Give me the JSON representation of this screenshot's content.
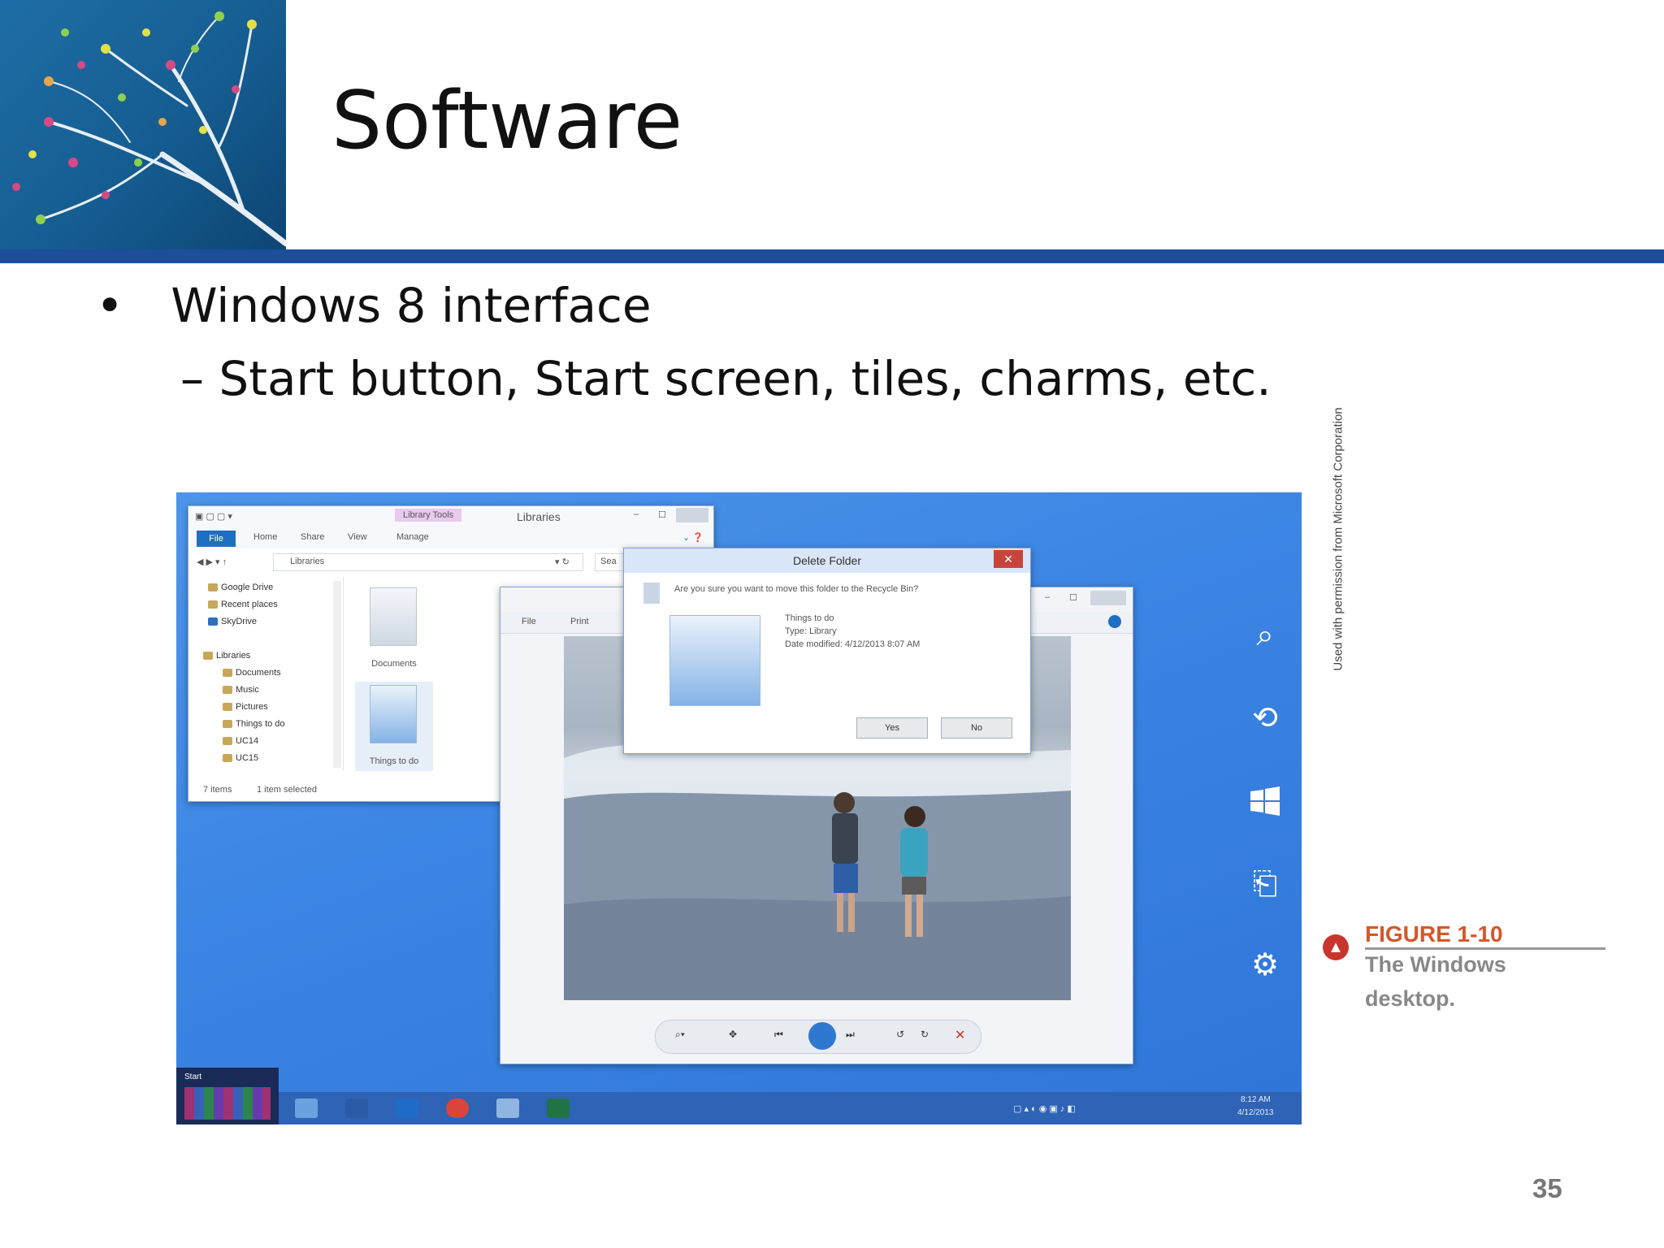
{
  "slide": {
    "title": "Software",
    "bullets": [
      {
        "text": "Windows 8 interface",
        "sub": "– Start button, Start screen, tiles, charms, etc."
      }
    ],
    "figure": {
      "label": "FIGURE 1-10",
      "caption_line1": "The Windows",
      "caption_line2": "desktop.",
      "credit": "Used with permission from Microsoft Corporation"
    },
    "page_number": "35"
  },
  "screenshot": {
    "explorer": {
      "title": "Libraries",
      "contextual_tab": "Library Tools",
      "tabs": [
        "File",
        "Home",
        "Share",
        "View",
        "Manage"
      ],
      "address": "Libraries",
      "search_placeholder": "Sea",
      "nav_items": [
        "Google Drive",
        "Recent places",
        "SkyDrive",
        "Libraries",
        "Documents",
        "Music",
        "Pictures",
        "Things to do",
        "UC14",
        "UC15"
      ],
      "content_items": [
        "Documents",
        "Things to do"
      ],
      "status": {
        "items": "7 items",
        "selected": "1 item selected"
      }
    },
    "viewer": {
      "menu": [
        "File",
        "Print"
      ]
    },
    "dialog": {
      "title": "Delete Folder",
      "question": "Are you sure you want to move this folder to the Recycle Bin?",
      "item_name": "Things to do",
      "item_type": "Type: Library",
      "item_date": "Date modified: 4/12/2013 8:07 AM",
      "yes_label": "Yes",
      "no_label": "No",
      "close_glyph": "✕"
    },
    "charms": [
      "search-icon",
      "share-icon",
      "start-icon",
      "devices-icon",
      "settings-icon"
    ],
    "taskbar": {
      "start_label": "Start",
      "apps": [
        "ie-icon",
        "word-icon",
        "outlook-icon",
        "chrome-icon",
        "photo-viewer-icon",
        "excel-icon"
      ],
      "time": "8:12 AM",
      "date": "4/12/2013"
    },
    "colors": {
      "desktop_blue": "#3d86e4",
      "taskbar_blue": "#2e63b5",
      "header_rule": "#1c4e9b",
      "figure_label": "#d4572a"
    }
  }
}
